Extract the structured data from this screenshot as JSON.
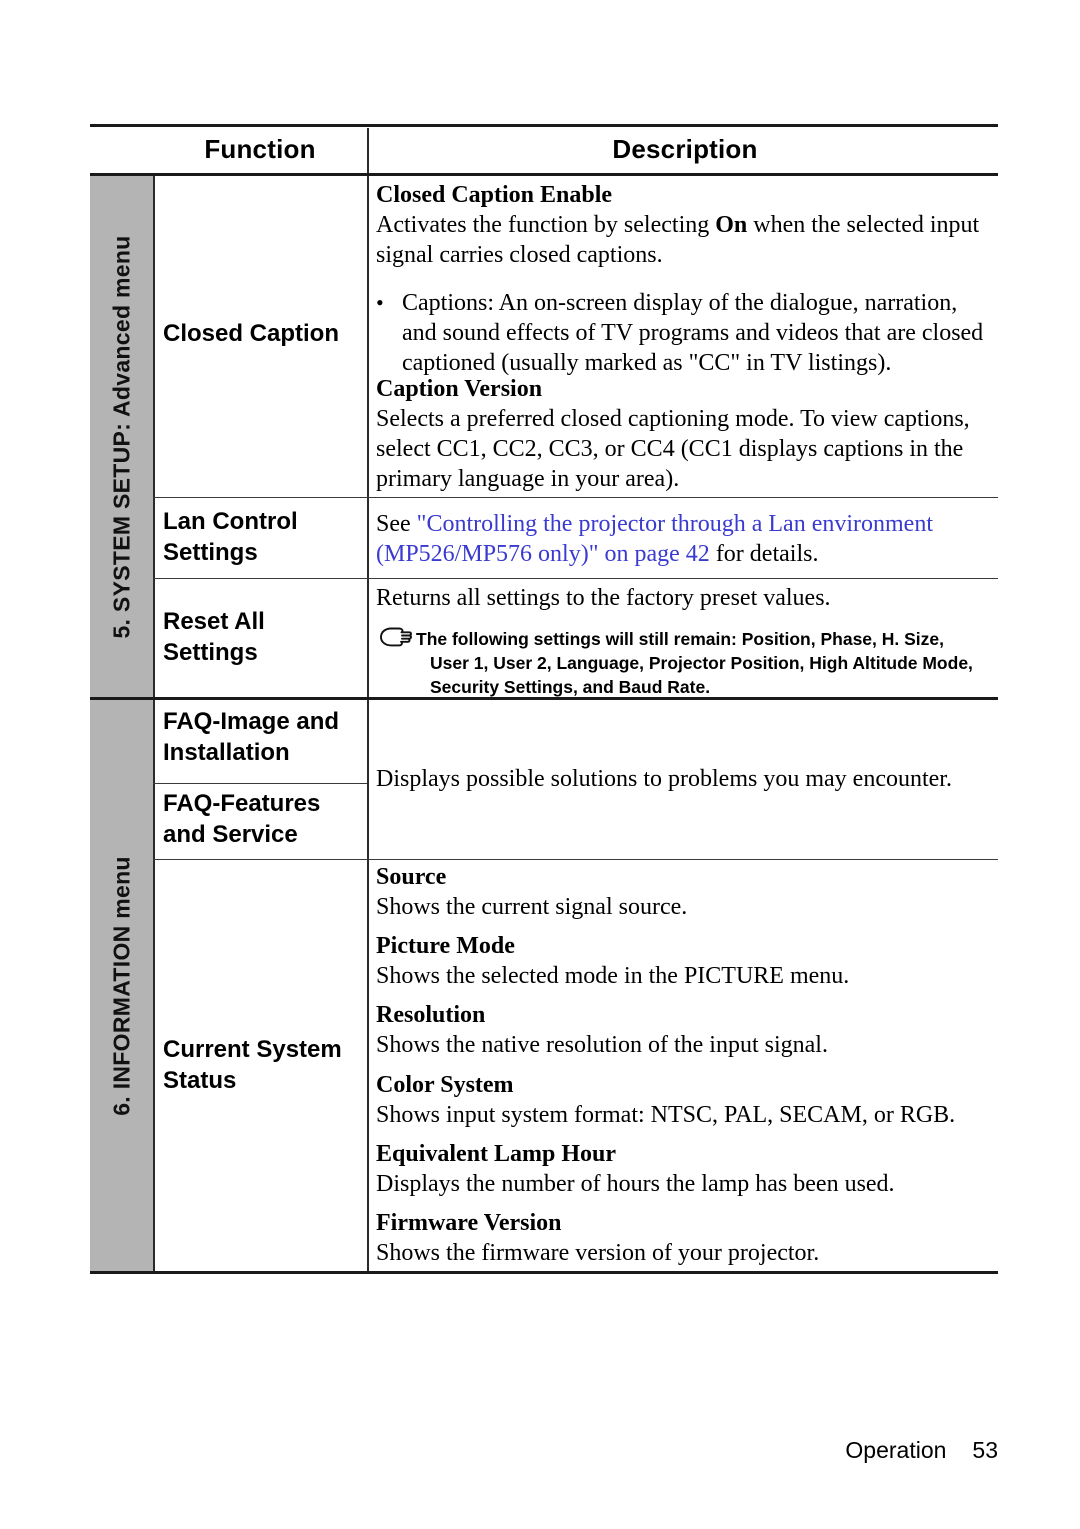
{
  "document": {
    "table_header": {
      "function": "Function",
      "description": "Description"
    },
    "sections": [
      {
        "id": "system-setup-advanced",
        "tab_label": "5. SYSTEM SETUP: Advanced menu",
        "rows": [
          {
            "id": "closed-caption",
            "function": "Closed Caption",
            "blocks": [
              {
                "subtitle": "Closed Caption Enable",
                "body_pre": "Activates the function by selecting ",
                "body_bold": "On",
                "body_post": " when the selected input signal carries closed captions."
              },
              {
                "bullet": "Captions: An on-screen display of the dialogue, narration, and sound effects of TV programs and videos that are closed captioned (usually marked as \"CC\" in TV listings)."
              },
              {
                "subtitle": "Caption Version",
                "body": "Selects a preferred closed captioning mode. To view captions, select CC1, CC2, CC3, or CC4 (CC1 displays captions in the primary language in your area)."
              }
            ]
          },
          {
            "id": "lan-control-settings",
            "function": "Lan Control Settings",
            "link_lead": "See ",
            "link_quote_open": "\"",
            "link_text": "Controlling the projector through a Lan environment (MP526/MP576 only)",
            "link_quote_close": "\"",
            "link_page_text": " on page 42",
            "link_tail": " for details."
          },
          {
            "id": "reset-all-settings",
            "function": "Reset All Settings",
            "body": "Returns all settings to the factory preset values.",
            "note_icon": "pointing-hand-icon",
            "note_line1": "The following settings will still remain: Position, Phase, H. Size,",
            "note_line2": "User 1, User 2, Language, Projector Position, High Altitude Mode,",
            "note_line3": "Security Settings, and Baud Rate."
          }
        ]
      },
      {
        "id": "information-menu",
        "tab_label": "6. INFORMATION menu",
        "rows": [
          {
            "id": "faq-image-installation",
            "function": "FAQ-Image and Installation"
          },
          {
            "id": "faq-features-service",
            "function": "FAQ-Features and Service",
            "shared_description": "Displays possible solutions to problems you may encounter."
          },
          {
            "id": "current-system-status",
            "function": "Current System Status",
            "items": [
              {
                "subtitle": "Source",
                "body": "Shows the current signal source."
              },
              {
                "subtitle": "Picture Mode",
                "body_pre": "Shows the selected mode in the ",
                "body_bold": "PICTURE",
                "body_post": " menu."
              },
              {
                "subtitle": "Resolution",
                "body": "Shows the native resolution of the input signal."
              },
              {
                "subtitle": "Color System",
                "body": "Shows input system format: NTSC, PAL, SECAM, or RGB."
              },
              {
                "subtitle": "Equivalent Lamp Hour",
                "body": "Displays the number of hours the lamp has been used."
              },
              {
                "subtitle": "Firmware Version",
                "body": "Shows the firmware version of your projector."
              }
            ]
          }
        ]
      }
    ],
    "footer": {
      "chapter": "Operation",
      "page_number": "53"
    },
    "colors": {
      "tab_gray": "#b4b4b4",
      "link_blue": "#3a3ad0",
      "rule_black": "#1a1a1a"
    }
  }
}
